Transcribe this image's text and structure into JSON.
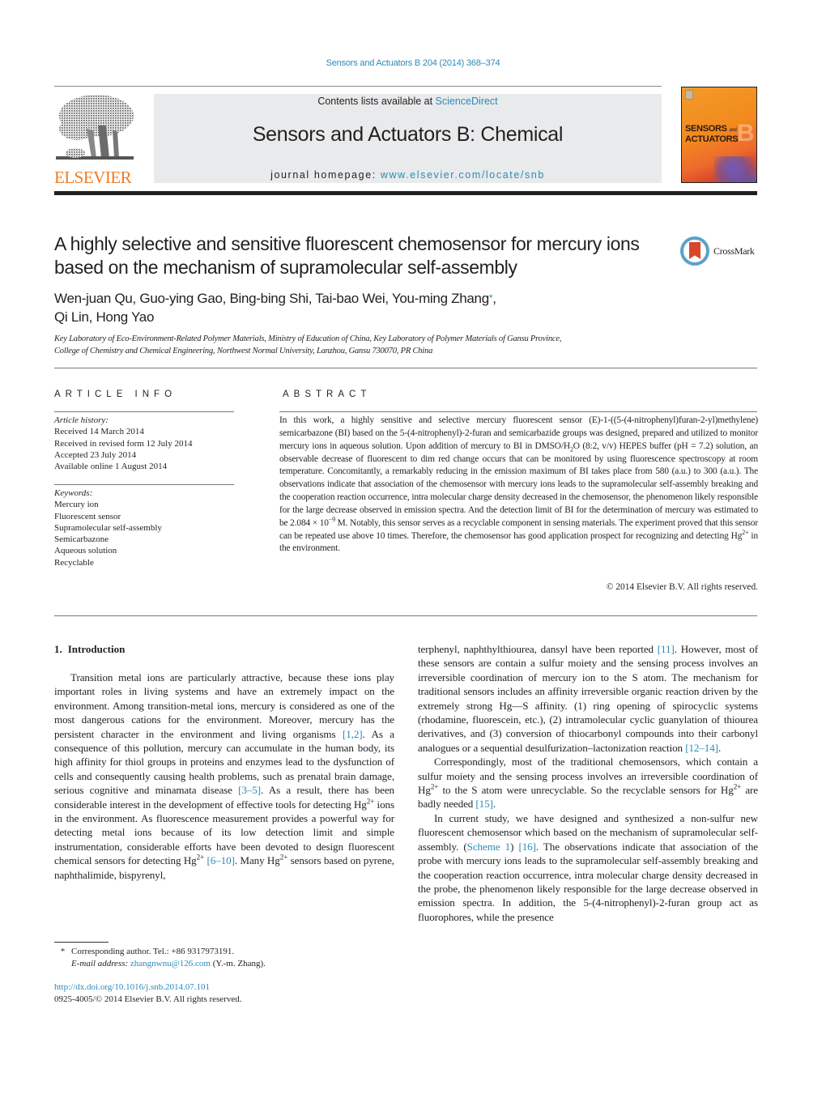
{
  "citation": "Sensors and Actuators B 204 (2014) 368–374",
  "header": {
    "publisher_wordmark": "ELSEVIER",
    "contents_prefix": "Contents lists available at ",
    "contents_link": "ScienceDirect",
    "journal_title": "Sensors and Actuators B: Chemical",
    "homepage_prefix": "journal homepage: ",
    "homepage_link": "www.elsevier.com/locate/snb",
    "cover": {
      "line1": "SENSORS",
      "line1_small": "and",
      "line2": "ACTUATORS",
      "letter": "B"
    },
    "crossmark_label": "CrossMark"
  },
  "article": {
    "title": "A highly selective and sensitive fluorescent chemosensor for mercury ions based on the mechanism of supramolecular self-assembly",
    "authors_line1": "Wen-juan Qu, Guo-ying Gao, Bing-bing Shi, Tai-bao Wei, You-ming Zhang",
    "author_mark": "*",
    "authors_line1_end": ",",
    "authors_line2": "Qi Lin, Hong Yao",
    "affiliation_line1": "Key Laboratory of Eco-Environment-Related Polymer Materials, Ministry of Education of China, Key Laboratory of Polymer Materials of Gansu Province,",
    "affiliation_line2": "College of Chemistry and Chemical Engineering, Northwest Normal University, Lanzhou, Gansu 730070, PR China"
  },
  "article_info": {
    "heading": "ARTICLE INFO",
    "history_label": "Article history:",
    "history": [
      "Received 14 March 2014",
      "Received in revised form 12 July 2014",
      "Accepted 23 July 2014",
      "Available online 1 August 2014"
    ],
    "keywords_label": "Keywords:",
    "keywords": [
      "Mercury ion",
      "Fluorescent sensor",
      "Supramolecular self-assembly",
      "Semicarbazone",
      "Aqueous solution",
      "Recyclable"
    ]
  },
  "abstract": {
    "heading": "ABSTRACT",
    "part1": "In this work, a highly sensitive and selective mercury fluorescent sensor (E)-1-((5-(4-nitrophenyl)furan-2-yl)methylene) semicarbazone (BI) based on the 5-(4-nitrophenyl)-2-furan and semicarbazide groups was designed, prepared and utilized to monitor mercury ions in aqueous solution. Upon addition of mercury to BI in DMSO/H",
    "sub2": "2",
    "part2": "O (8:2, v/v) HEPES buffer (pH = 7.2) solution, an observable decrease of fluorescent to dim red change occurs that can be monitored by using fluorescence spectroscopy at room temperature. Concomitantly, a remarkably reducing in the emission maximum of BI takes place from 580 (a.u.) to 300 (a.u.). The observations indicate that association of the chemosensor with mercury ions leads to the supramolecular self-assembly breaking and the cooperation reaction occurrence, intra molecular charge density decreased in the chemosensor, the phenomenon likely responsible for the large decrease observed in emission spectra. And the detection limit of BI for the determination of mercury was estimated to be 2.084 × 10",
    "exp": "−9",
    "part3": " M. Notably, this sensor serves as a recyclable component in sensing materials. The experiment proved that this sensor can be repeated use above 10 times. Therefore, the chemosensor has good application prospect for recognizing and detecting Hg",
    "charge": "2+",
    "part4": " in the environment.",
    "copyright": "© 2014 Elsevier B.V. All rights reserved."
  },
  "body": {
    "section_number": "1.",
    "section_title": "Introduction",
    "left": {
      "p1_a": "Transition metal ions are particularly attractive, because these ions play important roles in living systems and have an extremely impact on the environment. Among transition-metal ions, mercury is considered as one of the most dangerous cations for the environment. Moreover, mercury has the persistent character in the environment and living organisms ",
      "ref_1_2": "[1,2]",
      "p1_b": ". As a consequence of this pollution, mercury can accumulate in the human body, its high affinity for thiol groups in proteins and enzymes lead to the dysfunction of cells and consequently causing health problems, such as prenatal brain damage, serious cognitive and minamata disease ",
      "ref_3_5": "[3–5]",
      "p1_c": ". As a result, there has been considerable interest in the development of effective tools for detecting Hg",
      "charge": "2+",
      "p1_d": " ions in the environment. As fluorescence measurement provides a powerful way for detecting metal ions because of its low detection limit and simple instrumentation, considerable efforts have been devoted to design fluorescent chemical sensors for detecting Hg",
      "p1_e": " ",
      "ref_6_10": "[6–10]",
      "p1_f": ". Many Hg",
      "p1_g": " sensors based on pyrene, naphthalimide, bispyrenyl,"
    },
    "right": {
      "p1_a": "terphenyl, naphthylthiourea, dansyl have been reported ",
      "ref_11": "[11]",
      "p1_b": ". However, most of these sensors are contain a sulfur moiety and the sensing process involves an irreversible coordination of mercury ion to the S atom. The mechanism for traditional sensors includes an affinity irreversible organic reaction driven by the extremely strong Hg—S affinity. (1) ring opening of spirocyclic systems (rhodamine, fluorescein, etc.), (2) intramolecular cyclic guanylation of thiourea derivatives, and (3) conversion of thiocarbonyl compounds into their carbonyl analogues or a sequential desulfurization–lactonization reaction ",
      "ref_12_14": "[12–14]",
      "p1_c": ".",
      "p2_a": "Correspondingly, most of the traditional chemosensors, which contain a sulfur moiety and the sensing process involves an irreversible coordination of Hg",
      "charge": "2+",
      "p2_b": " to the S atom were unrecyclable. So the recyclable sensors for Hg",
      "p2_c": " are badly needed ",
      "ref_15": "[15]",
      "p2_d": ".",
      "p3_a": "In current study, we have designed and synthesized a non-sulfur new fluorescent chemosensor which based on the mechanism of supramolecular self-assembly. (",
      "scheme_1": "Scheme 1",
      "p3_b": ") ",
      "ref_16": "[16]",
      "p3_c": ". The observations indicate that association of the probe with mercury ions leads to the supramolecular self-assembly breaking and the cooperation reaction occurrence, intra molecular charge density decreased in the probe, the phenomenon likely responsible for the large decrease observed in emission spectra. In addition, the 5-(4-nitrophenyl)-2-furan group act as fluorophores, while the presence"
    }
  },
  "footnote": {
    "marker": "*",
    "corresponding": "Corresponding author. Tel.: +86 9317973191.",
    "email_label": "E-mail address:",
    "email": "zhangnwnu@126.com",
    "email_suffix": " (Y.-m. Zhang).",
    "doi": "http://dx.doi.org/10.1016/j.snb.2014.07.101",
    "issn_line": "0925-4005/© 2014 Elsevier B.V. All rights reserved."
  },
  "colors": {
    "link": "#2a8ab8",
    "elsevier_orange": "#f07c23",
    "header_box": "#e9eaeb",
    "text": "#231f20"
  }
}
